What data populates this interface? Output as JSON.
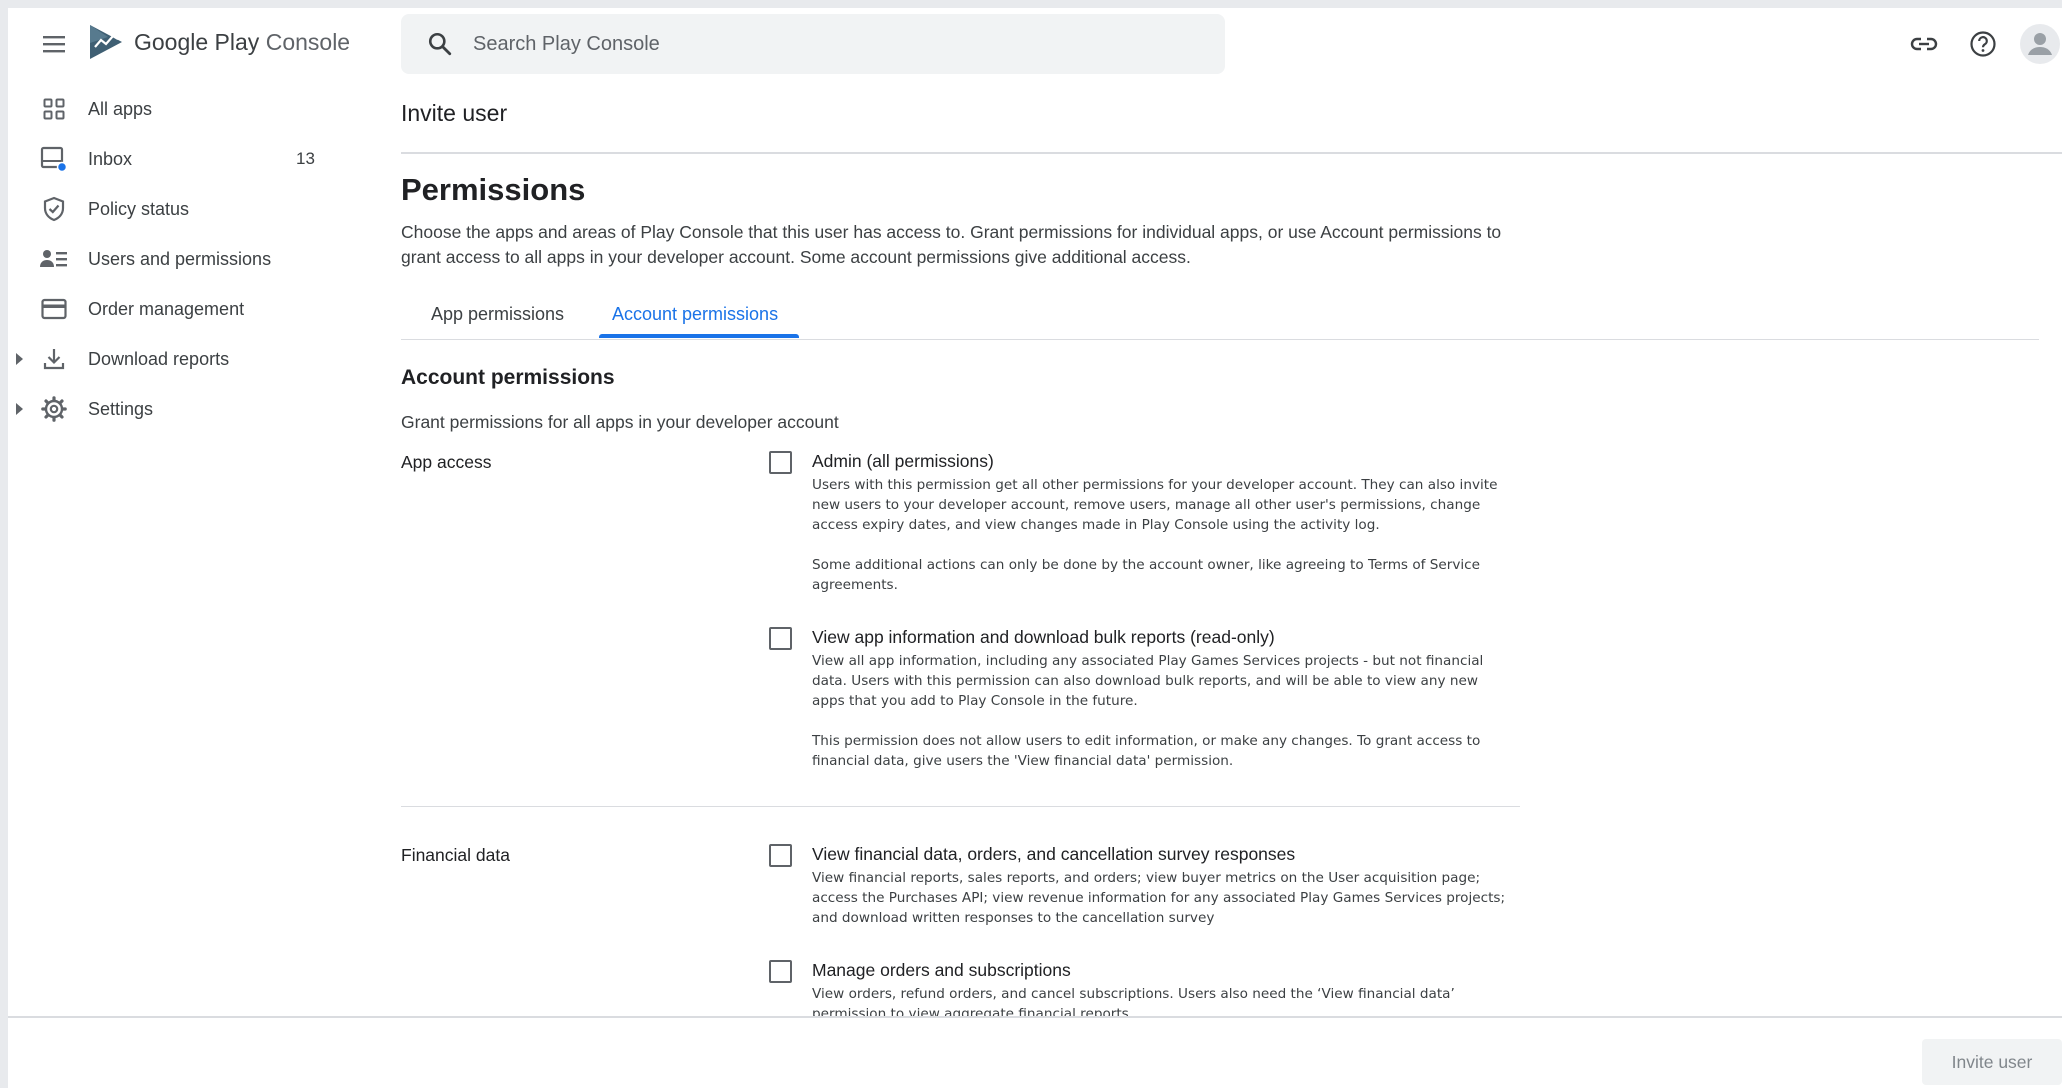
{
  "app": {
    "logo_google_play": "Google Play",
    "logo_console": "Console"
  },
  "search": {
    "placeholder": "Search Play Console"
  },
  "header_icons": [
    "link-icon",
    "help-icon",
    "account-avatar"
  ],
  "sidebar": {
    "items": [
      {
        "label": "All apps",
        "icon": "grid-icon",
        "count": "",
        "expandable": false
      },
      {
        "label": "Inbox",
        "icon": "inbox-icon",
        "count": "13",
        "expandable": false
      },
      {
        "label": "Policy status",
        "icon": "shield-icon",
        "count": "",
        "expandable": false
      },
      {
        "label": "Users and permissions",
        "icon": "users-icon",
        "count": "",
        "expandable": false
      },
      {
        "label": "Order management",
        "icon": "card-icon",
        "count": "",
        "expandable": false
      },
      {
        "label": "Download reports",
        "icon": "download-icon",
        "count": "",
        "expandable": true
      },
      {
        "label": "Settings",
        "icon": "gear-icon",
        "count": "",
        "expandable": true
      }
    ]
  },
  "main": {
    "page_title": "Invite user",
    "section_title": "Permissions",
    "section_desc": "Choose the apps and areas of Play Console that this user has access to. Grant permissions for individual apps, or use Account permissions to grant access to all apps in your developer account. Some account permissions give additional access.",
    "tabs": [
      {
        "label": "App permissions",
        "active": false
      },
      {
        "label": "Account permissions",
        "active": true
      }
    ],
    "sub_title": "Account permissions",
    "sub_desc": "Grant permissions for all apps in your developer account",
    "groups": [
      {
        "label": "App access",
        "permissions": [
          {
            "title": "Admin (all permissions)",
            "checked": false,
            "desc": [
              "Users with this permission get all other permissions for your developer account. They can also invite new users to your developer account, remove users, manage all other user's permissions, change access expiry dates, and view changes made in Play Console using the activity log.",
              "Some additional actions can only be done by the account owner, like agreeing to Terms of Service agreements."
            ]
          },
          {
            "title": "View app information and download bulk reports (read-only)",
            "checked": false,
            "desc": [
              "View all app information, including any associated Play Games Services projects - but not financial data. Users with this permission can also download bulk reports, and will be able to view any new apps that you add to Play Console in the future.",
              "This permission does not allow users to edit information, or make any changes. To grant access to financial data, give users the 'View financial data' permission."
            ]
          }
        ]
      },
      {
        "label": "Financial data",
        "permissions": [
          {
            "title": "View financial data, orders, and cancellation survey responses",
            "checked": false,
            "desc": [
              "View financial reports, sales reports, and orders; view buyer metrics on the User acquisition page; access the Purchases API; view revenue information for any associated Play Games Services projects; and download written responses to the cancellation survey"
            ]
          },
          {
            "title": "Manage orders and subscriptions",
            "checked": false,
            "desc": [
              "View orders, refund orders, and cancel subscriptions. Users also need the ‘View financial data’ permission to view aggregate financial reports."
            ]
          }
        ]
      }
    ]
  },
  "footer": {
    "invite_button": "Invite user",
    "invite_enabled": false
  },
  "colors": {
    "accent": "#1a73e8",
    "text": "#202124",
    "muted": "#5f6368",
    "divider": "#dadce0"
  }
}
